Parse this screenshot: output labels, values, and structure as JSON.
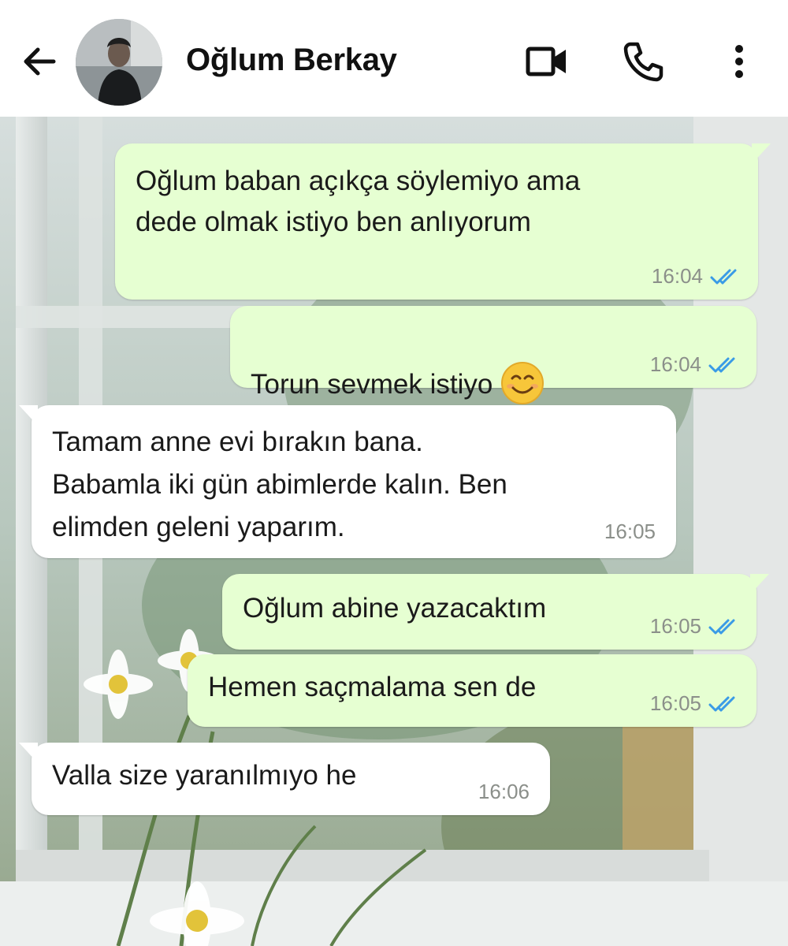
{
  "header": {
    "contact_name": "Oğlum Berkay",
    "back_icon": "arrow-left-icon",
    "video_icon": "video-call-icon",
    "phone_icon": "phone-icon",
    "menu_icon": "more-vertical-icon"
  },
  "colors": {
    "outgoing_bubble": "#e6ffd2",
    "incoming_bubble": "#ffffff",
    "read_ticks": "#3a9be6",
    "timestamp": "#8b8f8a"
  },
  "messages": [
    {
      "direction": "outgoing",
      "text": "Oğlum baban açıkça söylemiyo ama\ndede olmak istiyo ben anlıyorum",
      "time": "16:04",
      "status": "read"
    },
    {
      "direction": "outgoing",
      "text": "Torun sevmek istiyo",
      "emoji": "smiling-face-icon",
      "time": "16:04",
      "status": "read"
    },
    {
      "direction": "incoming",
      "text": "Tamam anne evi bırakın bana.\nBabamla iki gün abimlerde kalın. Ben\nelimden geleni yaparım.",
      "time": "16:05"
    },
    {
      "direction": "outgoing",
      "text": "Oğlum abine yazacaktım",
      "time": "16:05",
      "status": "read"
    },
    {
      "direction": "outgoing",
      "text": "Hemen saçmalama sen de",
      "time": "16:05",
      "status": "read"
    },
    {
      "direction": "incoming",
      "text": "Valla size yaranılmıyo he",
      "time": "16:06"
    }
  ]
}
